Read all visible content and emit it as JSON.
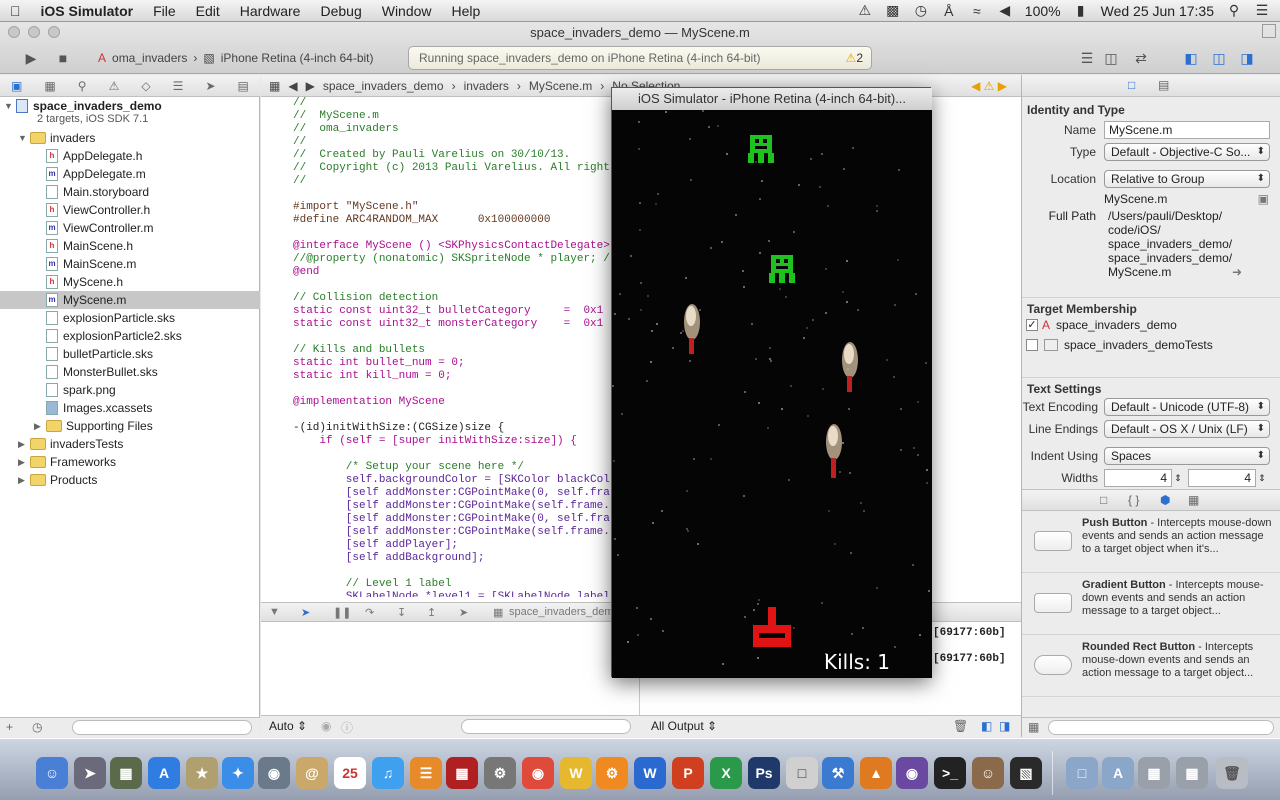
{
  "menubar": {
    "app": "iOS Simulator",
    "items": [
      "File",
      "Edit",
      "Hardware",
      "Debug",
      "Window",
      "Help"
    ],
    "battery": "100%",
    "clock": "Wed 25 Jun  17:35"
  },
  "toolbar": {
    "window_title": "space_invaders_demo  —  MyScene.m",
    "scheme": "oma_invaders",
    "device": "iPhone Retina (4-inch 64-bit)",
    "activity": "Running space_invaders_demo on iPhone Retina (4-inch 64-bit)",
    "warning_count": "2"
  },
  "navigator": {
    "project": "space_invaders_demo",
    "project_sub": "2 targets, iOS SDK 7.1",
    "items": [
      {
        "label": "invaders",
        "kind": "folder",
        "indent": 1
      },
      {
        "label": "AppDelegate.h",
        "kind": "h",
        "indent": 2
      },
      {
        "label": "AppDelegate.m",
        "kind": "m",
        "indent": 2
      },
      {
        "label": "Main.storyboard",
        "kind": "sb",
        "indent": 2
      },
      {
        "label": "ViewController.h",
        "kind": "h",
        "indent": 2
      },
      {
        "label": "ViewController.m",
        "kind": "m",
        "indent": 2
      },
      {
        "label": "MainScene.h",
        "kind": "h",
        "indent": 2
      },
      {
        "label": "MainScene.m",
        "kind": "m",
        "indent": 2
      },
      {
        "label": "MyScene.h",
        "kind": "h",
        "indent": 2
      },
      {
        "label": "MyScene.m",
        "kind": "m",
        "indent": 2
      },
      {
        "label": "explosionParticle.sks",
        "kind": "sks",
        "indent": 2
      },
      {
        "label": "explosionParticle2.sks",
        "kind": "sks",
        "indent": 2
      },
      {
        "label": "bulletParticle.sks",
        "kind": "sks",
        "indent": 2
      },
      {
        "label": "MonsterBullet.sks",
        "kind": "sks",
        "indent": 2
      },
      {
        "label": "spark.png",
        "kind": "png",
        "indent": 2
      },
      {
        "label": "Images.xcassets",
        "kind": "asset",
        "indent": 2
      },
      {
        "label": "Supporting Files",
        "kind": "folder",
        "indent": 2
      },
      {
        "label": "invadersTests",
        "kind": "folder",
        "indent": 1
      },
      {
        "label": "Frameworks",
        "kind": "folder",
        "indent": 1
      },
      {
        "label": "Products",
        "kind": "folder",
        "indent": 1
      }
    ]
  },
  "editor": {
    "jump": [
      "space_invaders_demo",
      "invaders",
      "MyScene.m",
      "No Selection"
    ],
    "code_lines": [
      "//",
      "//  MyScene.m",
      "//  oma_invaders",
      "//",
      "//  Created by Pauli Varelius on 30/10/13.",
      "//  Copyright (c) 2013 Pauli Varelius. All rights",
      "//",
      "",
      "#import \"MyScene.h\"",
      "#define ARC4RANDOM_MAX      0x100000000",
      "",
      "@interface MyScene () <SKPhysicsContactDelegate>",
      "//@property (nonatomic) SKSpriteNode * player; /",
      "@end",
      "",
      "// Collision detection",
      "static const uint32_t bulletCategory     =  0x1",
      "static const uint32_t monsterCategory    =  0x1",
      "",
      "// Kills and bullets",
      "static int bullet_num = 0;",
      "static int kill_num = 0;",
      "",
      "@implementation MyScene",
      "",
      "-(id)initWithSize:(CGSize)size {",
      "    if (self = [super initWithSize:size]) {",
      "",
      "        /* Setup your scene here */",
      "        self.backgroundColor = [SKColor blackCol",
      "        [self addMonster:CGPointMake(0, self.fra",
      "        [self addMonster:CGPointMake(self.frame.",
      "        [self addMonster:CGPointMake(0, self.fra",
      "        [self addMonster:CGPointMake(self.frame.",
      "        [self addPlayer];",
      "        [self addBackground];",
      "",
      "        // Level 1 label",
      "        SKLabelNode *level1 = [SKLabelNode label"
    ],
    "debug_tab": "space_invaders_demo",
    "console_lines": [
      "[69177:60b]",
      "[69177:60b]"
    ],
    "auto_label": "Auto",
    "output_label": "All Output"
  },
  "simulator": {
    "title": "iOS Simulator - iPhone Retina (4-inch 64-bit)...",
    "kills_label": "Kills: 1"
  },
  "inspector": {
    "identity_header": "Identity and Type",
    "name_label": "Name",
    "name_value": "MyScene.m",
    "type_label": "Type",
    "type_value": "Default - Objective-C So...",
    "location_label": "Location",
    "location_value": "Relative to Group",
    "location_file": "MyScene.m",
    "fullpath_label": "Full Path",
    "fullpath_lines": [
      "/Users/pauli/Desktop/",
      "code/iOS/",
      "space_invaders_demo/",
      "space_invaders_demo/",
      "MyScene.m"
    ],
    "target_header": "Target Membership",
    "targets": [
      "space_invaders_demo",
      "space_invaders_demoTests"
    ],
    "text_header": "Text Settings",
    "encoding_label": "Text Encoding",
    "encoding_value": "Default - Unicode (UTF-8)",
    "endings_label": "Line Endings",
    "endings_value": "Default - OS X / Unix (LF)",
    "indent_label": "Indent Using",
    "indent_value": "Spaces",
    "widths_label": "Widths",
    "width_a": "4",
    "width_b": "4",
    "library": [
      {
        "title": "Push Button",
        "desc": " - Intercepts mouse-down events and sends an action message to a target object when it's..."
      },
      {
        "title": "Gradient Button",
        "desc": " - Intercepts mouse-down events and sends an action message to a target object..."
      },
      {
        "title": "Rounded Rect Button",
        "desc": " - Intercepts mouse-down events and sends an action message to a target object..."
      }
    ]
  }
}
